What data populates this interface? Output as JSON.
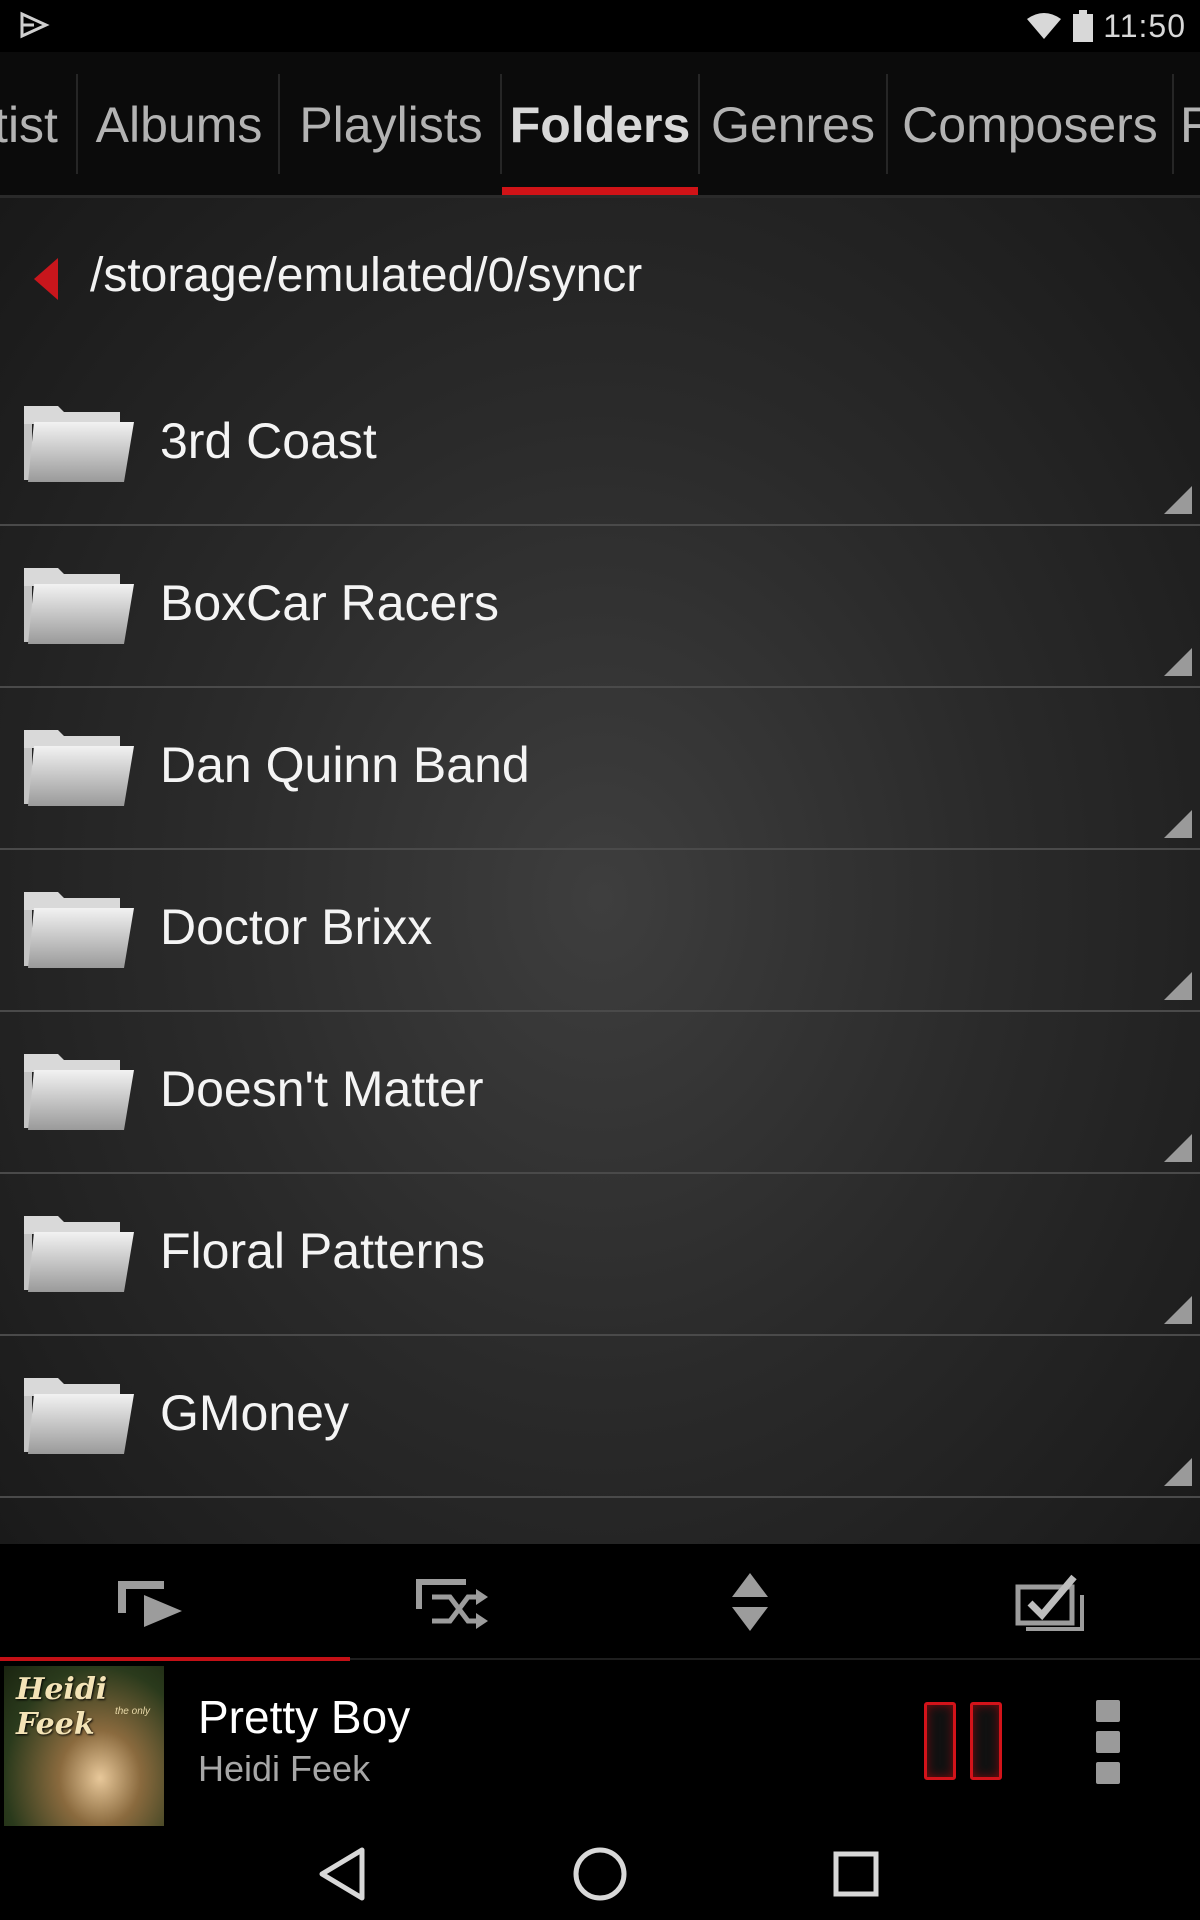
{
  "status_bar": {
    "time": "11:50",
    "icons": [
      "play-store-icon",
      "wifi-icon",
      "battery-icon"
    ]
  },
  "tabs": [
    {
      "label": "tist",
      "active": false
    },
    {
      "label": "Albums",
      "active": false
    },
    {
      "label": "Playlists",
      "active": false
    },
    {
      "label": "Folders",
      "active": true
    },
    {
      "label": "Genres",
      "active": false
    },
    {
      "label": "Composers",
      "active": false
    },
    {
      "label": "F",
      "active": false
    }
  ],
  "path": {
    "text": "/storage/emulated/0/syncr",
    "back_icon": "back-triangle-icon"
  },
  "folders": [
    {
      "name": "3rd Coast"
    },
    {
      "name": "BoxCar Racers"
    },
    {
      "name": "Dan Quinn Band"
    },
    {
      "name": "Doctor Brixx"
    },
    {
      "name": "Doesn't Matter"
    },
    {
      "name": "Floral Patterns"
    },
    {
      "name": "GMoney"
    }
  ],
  "action_bar": {
    "buttons": [
      "play-all-icon",
      "shuffle-all-icon",
      "sort-icon",
      "multi-select-icon"
    ]
  },
  "now_playing": {
    "title": "Pretty Boy",
    "artist": "Heidi Feek",
    "album_art_text": "Heidi Feek",
    "album_art_subtext": "the only"
  },
  "colors": {
    "accent": "#d01317",
    "background": "#000000",
    "list_bg": "#2e2e2e"
  }
}
